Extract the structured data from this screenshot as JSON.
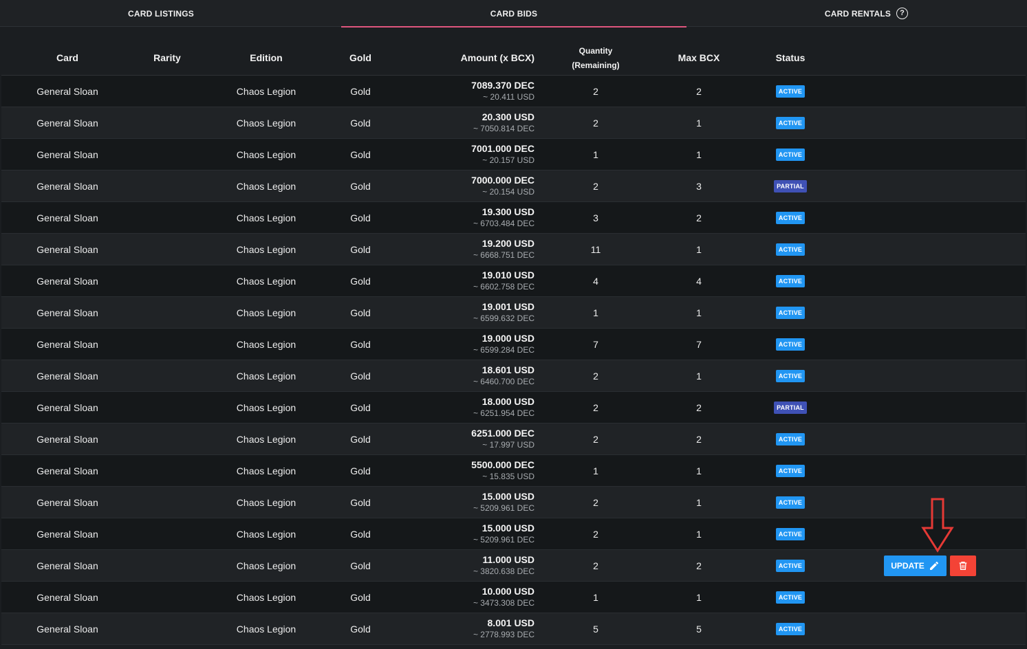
{
  "tabs": [
    {
      "label": "CARD LISTINGS",
      "active": false
    },
    {
      "label": "CARD BIDS",
      "active": true
    },
    {
      "label": "CARD RENTALS",
      "active": false,
      "has_help_icon": true
    }
  ],
  "table": {
    "headers": {
      "card": "Card",
      "rarity": "Rarity",
      "edition": "Edition",
      "gold": "Gold",
      "amount": "Amount (x BCX)",
      "quantity": "Quantity",
      "quantity_sub": "(Remaining)",
      "max_bcx": "Max BCX",
      "status": "Status"
    },
    "rows": [
      {
        "card": "General Sloan",
        "edition": "Chaos Legion",
        "gold": "Gold",
        "amount": "7089.370 DEC",
        "amount_sub": "~ 20.411 USD",
        "qty": "2",
        "max": "2",
        "status": "ACTIVE"
      },
      {
        "card": "General Sloan",
        "edition": "Chaos Legion",
        "gold": "Gold",
        "amount": "20.300 USD",
        "amount_sub": "~ 7050.814 DEC",
        "qty": "2",
        "max": "1",
        "status": "ACTIVE"
      },
      {
        "card": "General Sloan",
        "edition": "Chaos Legion",
        "gold": "Gold",
        "amount": "7001.000 DEC",
        "amount_sub": "~ 20.157 USD",
        "qty": "1",
        "max": "1",
        "status": "ACTIVE"
      },
      {
        "card": "General Sloan",
        "edition": "Chaos Legion",
        "gold": "Gold",
        "amount": "7000.000 DEC",
        "amount_sub": "~ 20.154 USD",
        "qty": "2",
        "max": "3",
        "status": "PARTIAL"
      },
      {
        "card": "General Sloan",
        "edition": "Chaos Legion",
        "gold": "Gold",
        "amount": "19.300 USD",
        "amount_sub": "~ 6703.484 DEC",
        "qty": "3",
        "max": "2",
        "status": "ACTIVE"
      },
      {
        "card": "General Sloan",
        "edition": "Chaos Legion",
        "gold": "Gold",
        "amount": "19.200 USD",
        "amount_sub": "~ 6668.751 DEC",
        "qty": "11",
        "max": "1",
        "status": "ACTIVE"
      },
      {
        "card": "General Sloan",
        "edition": "Chaos Legion",
        "gold": "Gold",
        "amount": "19.010 USD",
        "amount_sub": "~ 6602.758 DEC",
        "qty": "4",
        "max": "4",
        "status": "ACTIVE"
      },
      {
        "card": "General Sloan",
        "edition": "Chaos Legion",
        "gold": "Gold",
        "amount": "19.001 USD",
        "amount_sub": "~ 6599.632 DEC",
        "qty": "1",
        "max": "1",
        "status": "ACTIVE"
      },
      {
        "card": "General Sloan",
        "edition": "Chaos Legion",
        "gold": "Gold",
        "amount": "19.000 USD",
        "amount_sub": "~ 6599.284 DEC",
        "qty": "7",
        "max": "7",
        "status": "ACTIVE"
      },
      {
        "card": "General Sloan",
        "edition": "Chaos Legion",
        "gold": "Gold",
        "amount": "18.601 USD",
        "amount_sub": "~ 6460.700 DEC",
        "qty": "2",
        "max": "1",
        "status": "ACTIVE"
      },
      {
        "card": "General Sloan",
        "edition": "Chaos Legion",
        "gold": "Gold",
        "amount": "18.000 USD",
        "amount_sub": "~ 6251.954 DEC",
        "qty": "2",
        "max": "2",
        "status": "PARTIAL"
      },
      {
        "card": "General Sloan",
        "edition": "Chaos Legion",
        "gold": "Gold",
        "amount": "6251.000 DEC",
        "amount_sub": "~ 17.997 USD",
        "qty": "2",
        "max": "2",
        "status": "ACTIVE"
      },
      {
        "card": "General Sloan",
        "edition": "Chaos Legion",
        "gold": "Gold",
        "amount": "5500.000 DEC",
        "amount_sub": "~ 15.835 USD",
        "qty": "1",
        "max": "1",
        "status": "ACTIVE"
      },
      {
        "card": "General Sloan",
        "edition": "Chaos Legion",
        "gold": "Gold",
        "amount": "15.000 USD",
        "amount_sub": "~ 5209.961 DEC",
        "qty": "2",
        "max": "1",
        "status": "ACTIVE"
      },
      {
        "card": "General Sloan",
        "edition": "Chaos Legion",
        "gold": "Gold",
        "amount": "15.000 USD",
        "amount_sub": "~ 5209.961 DEC",
        "qty": "2",
        "max": "1",
        "status": "ACTIVE"
      },
      {
        "card": "General Sloan",
        "edition": "Chaos Legion",
        "gold": "Gold",
        "amount": "11.000 USD",
        "amount_sub": "~ 3820.638 DEC",
        "qty": "2",
        "max": "2",
        "status": "ACTIVE",
        "has_actions": true
      },
      {
        "card": "General Sloan",
        "edition": "Chaos Legion",
        "gold": "Gold",
        "amount": "10.000 USD",
        "amount_sub": "~ 3473.308 DEC",
        "qty": "1",
        "max": "1",
        "status": "ACTIVE"
      },
      {
        "card": "General Sloan",
        "edition": "Chaos Legion",
        "gold": "Gold",
        "amount": "8.001 USD",
        "amount_sub": "~ 2778.993 DEC",
        "qty": "5",
        "max": "5",
        "status": "ACTIVE"
      }
    ],
    "actions": {
      "update_label": "UPDATE",
      "update_icon": "pencil-icon",
      "delete_icon": "trash-icon"
    }
  },
  "annotation": {
    "icon": "down-arrow-icon",
    "color": "#e53935"
  },
  "colors": {
    "tab_underline": "#e0567e",
    "active_badge": "#2196f3",
    "partial_badge": "#3f51b5",
    "update_button": "#2196f3",
    "delete_button": "#f44336"
  }
}
